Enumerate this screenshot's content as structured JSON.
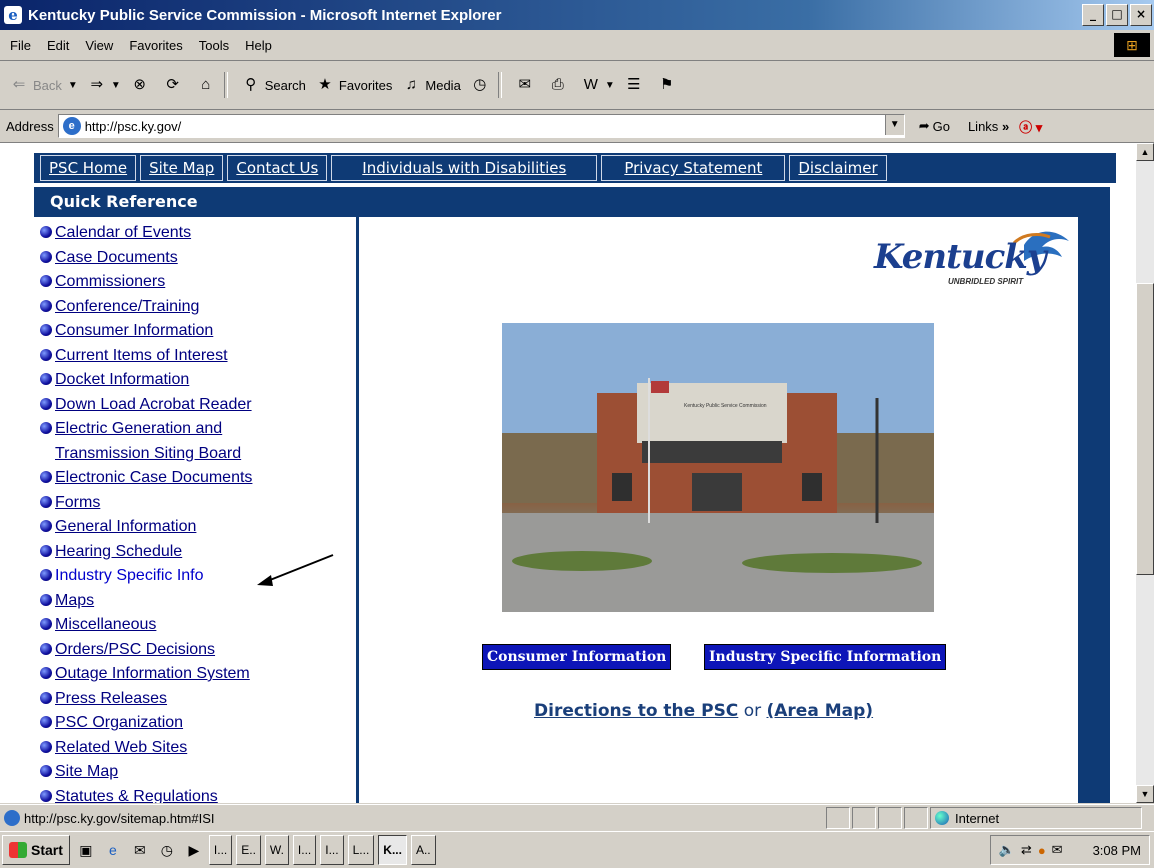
{
  "window": {
    "title": "Kentucky Public Service Commission - Microsoft Internet Explorer",
    "controls": [
      "_",
      "□",
      "×"
    ]
  },
  "menu": [
    "File",
    "Edit",
    "View",
    "Favorites",
    "Tools",
    "Help"
  ],
  "toolbar": {
    "back": "Back",
    "search": "Search",
    "favorites": "Favorites",
    "media": "Media"
  },
  "address": {
    "label": "Address",
    "url": "http://psc.ky.gov/",
    "go": "Go",
    "links": "Links"
  },
  "nav": [
    "PSC Home",
    "Site Map",
    "Contact Us",
    "Individuals with Disabilities",
    "Privacy Statement",
    "Disclaimer"
  ],
  "quick_reference": {
    "heading": "Quick Reference",
    "items": [
      "Calendar of Events",
      "Case Documents",
      "Commissioners",
      "Conference/Training",
      "Consumer Information",
      "Current Items of Interest",
      "Docket Information",
      "Down Load Acrobat Reader",
      "Electric Generation and Transmission Siting Board",
      "Electronic Case Documents",
      "Forms",
      "General Information",
      "Hearing Schedule",
      "Industry Specific Info",
      "Maps",
      "Miscellaneous",
      "Orders/PSC Decisions",
      "Outage Information System",
      "Press Releases",
      "PSC Organization",
      "Related Web Sites",
      "Site Map",
      "Statutes & Regulations"
    ]
  },
  "logo": {
    "word": "Kentucky",
    "tagline": "UNBRIDLED SPIRIT"
  },
  "photo_sign": "Kentucky Public Service Commission",
  "buttons": {
    "consumer": "Consumer Information",
    "industry": "Industry Specific Information"
  },
  "directions": {
    "link": "Directions to the PSC",
    "or": "or",
    "area": "(Area Map)"
  },
  "status": {
    "url": "http://psc.ky.gov/sitemap.htm#ISI",
    "zone": "Internet"
  },
  "taskbar": {
    "start": "Start",
    "tasks": [
      "I...",
      "E..",
      "W.",
      "I...",
      "I...",
      "L...",
      "K...",
      "A.."
    ],
    "time": "3:08 PM"
  }
}
